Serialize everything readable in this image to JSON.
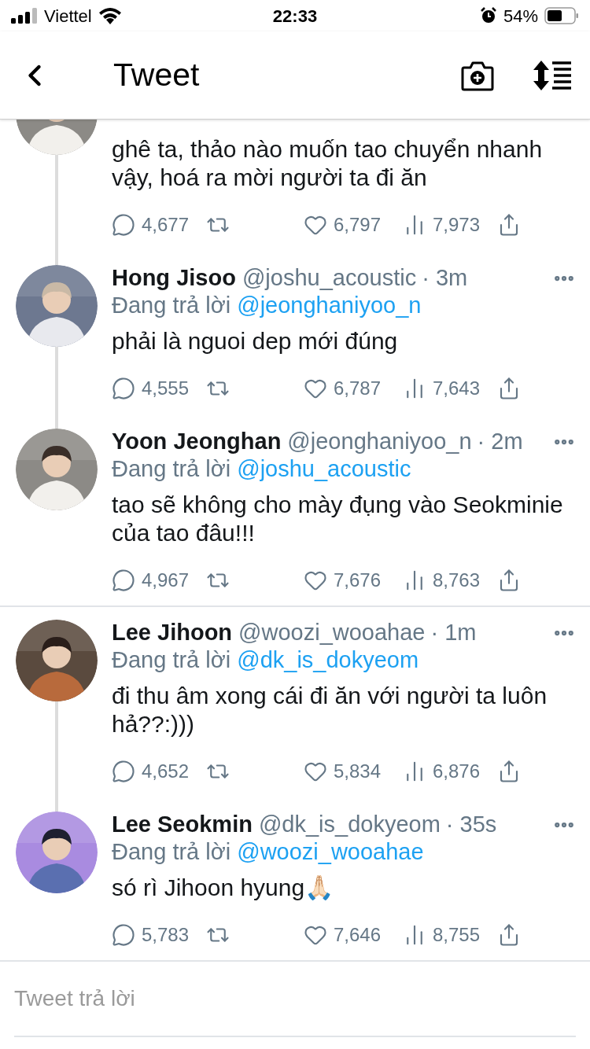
{
  "status_bar": {
    "carrier": "Viettel",
    "time": "22:33",
    "battery": "54%"
  },
  "header": {
    "title": "Tweet"
  },
  "tweets": [
    {
      "kind": "partial",
      "text": "ghê ta, thảo nào muốn tao chuyển nhanh vậy, hoá ra mời người ta đi ăn",
      "replies": "4,677",
      "likes": "6,797",
      "views": "7,973",
      "thread_line_below": true
    },
    {
      "kind": "full",
      "name": "Hong Jisoo",
      "handle": "@joshu_acoustic",
      "time": "· 3m",
      "replying_label": "Đang trả lời",
      "replying_to": "@jeonghaniyoo_n",
      "text": "phải là nguoi dep mới đúng",
      "replies": "4,555",
      "likes": "6,787",
      "views": "7,643",
      "thread_line_below": true
    },
    {
      "kind": "full",
      "name": "Yoon Jeonghan",
      "handle": "@jeonghaniyoo_n",
      "time": "· 2m",
      "replying_label": "Đang trả lời",
      "replying_to": "@joshu_acoustic",
      "text": "tao sẽ không cho mày đụng vào Seokminie của tao đâu!!!",
      "replies": "4,967",
      "likes": "7,676",
      "views": "8,763",
      "thread_line_below": false
    },
    {
      "kind": "full",
      "name": "Lee Jihoon",
      "handle": "@woozi_wooahae",
      "time": "· 1m",
      "replying_label": "Đang trả lời",
      "replying_to": "@dk_is_dokyeom",
      "text": "đi thu âm xong cái đi ăn với người ta luôn hả??:)))",
      "replies": "4,652",
      "likes": "5,834",
      "views": "6,876",
      "thread_line_below": true
    },
    {
      "kind": "full",
      "name": "Lee Seokmin",
      "handle": "@dk_is_dokyeom",
      "time": "· 35s",
      "replying_label": "Đang trả lời",
      "replying_to": "@woozi_wooahae",
      "text": "só rì Jihoon hyung🙏🏻",
      "replies": "5,783",
      "likes": "7,646",
      "views": "8,755",
      "thread_line_below": false
    }
  ],
  "reply_field": {
    "placeholder": "Tweet trả lời"
  }
}
